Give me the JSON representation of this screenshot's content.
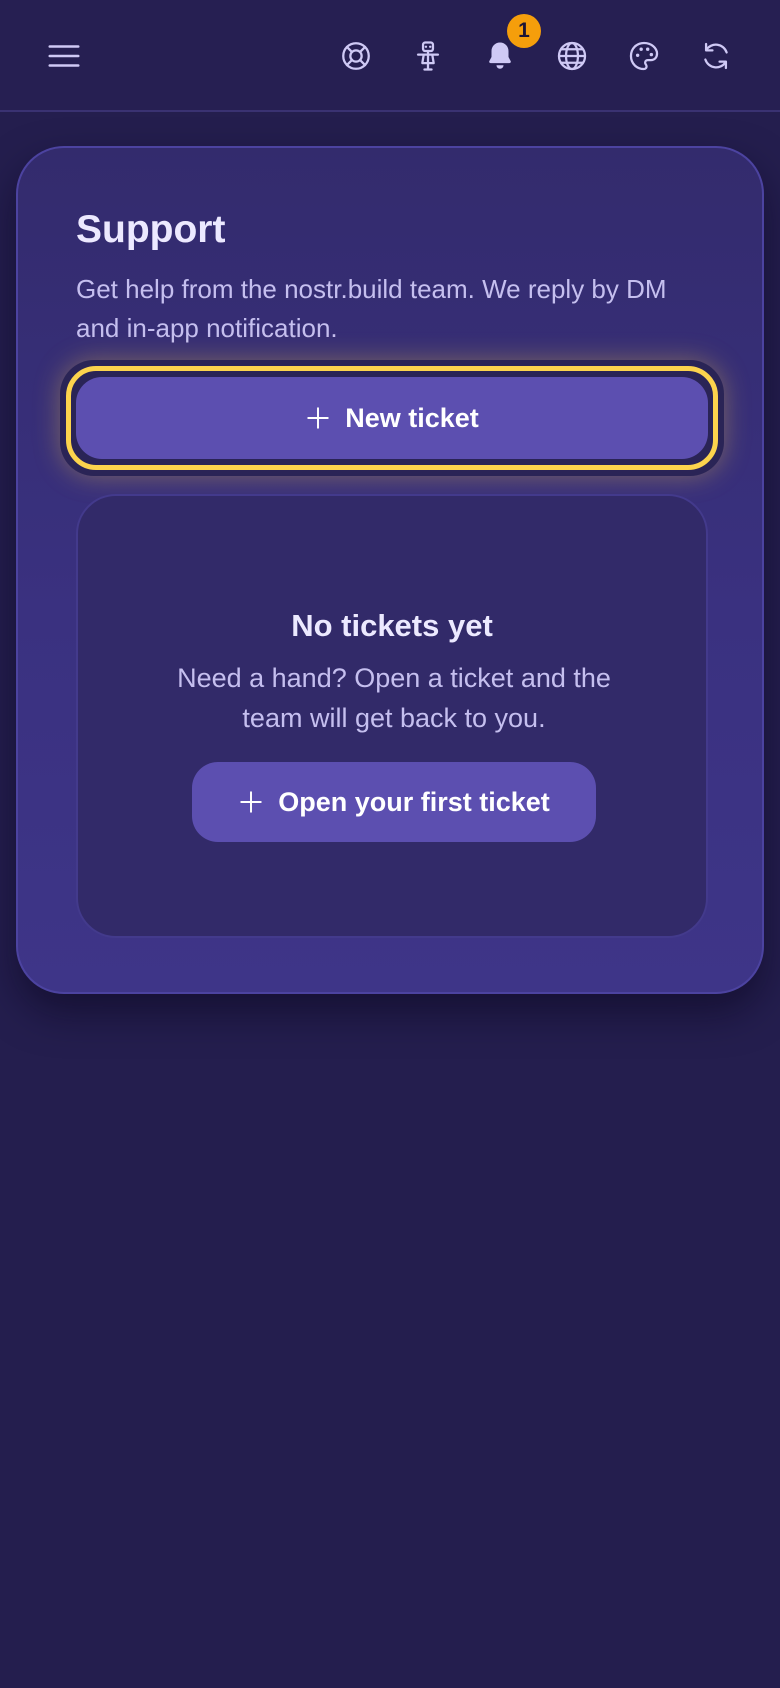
{
  "header": {
    "icons": [
      "menu-icon",
      "lifebuoy-icon",
      "scarecrow-icon",
      "bell-icon",
      "globe-icon",
      "palette-icon",
      "refresh-icon"
    ],
    "notification_count": "1"
  },
  "support": {
    "title": "Support",
    "description": "Get help from the nostr.build team. We reply by DM and in-app notification.",
    "new_ticket_label": "New ticket",
    "empty_state": {
      "title": "No tickets yet",
      "description": "Need a hand? Open a ticket and the team will get back to you.",
      "button_label": "Open your first ticket"
    }
  },
  "colors": {
    "background": "#241e4e",
    "card": "#3a3180",
    "button": "#5c4fb0",
    "focus_ring": "#fcd34d",
    "badge": "#f59e0b"
  }
}
